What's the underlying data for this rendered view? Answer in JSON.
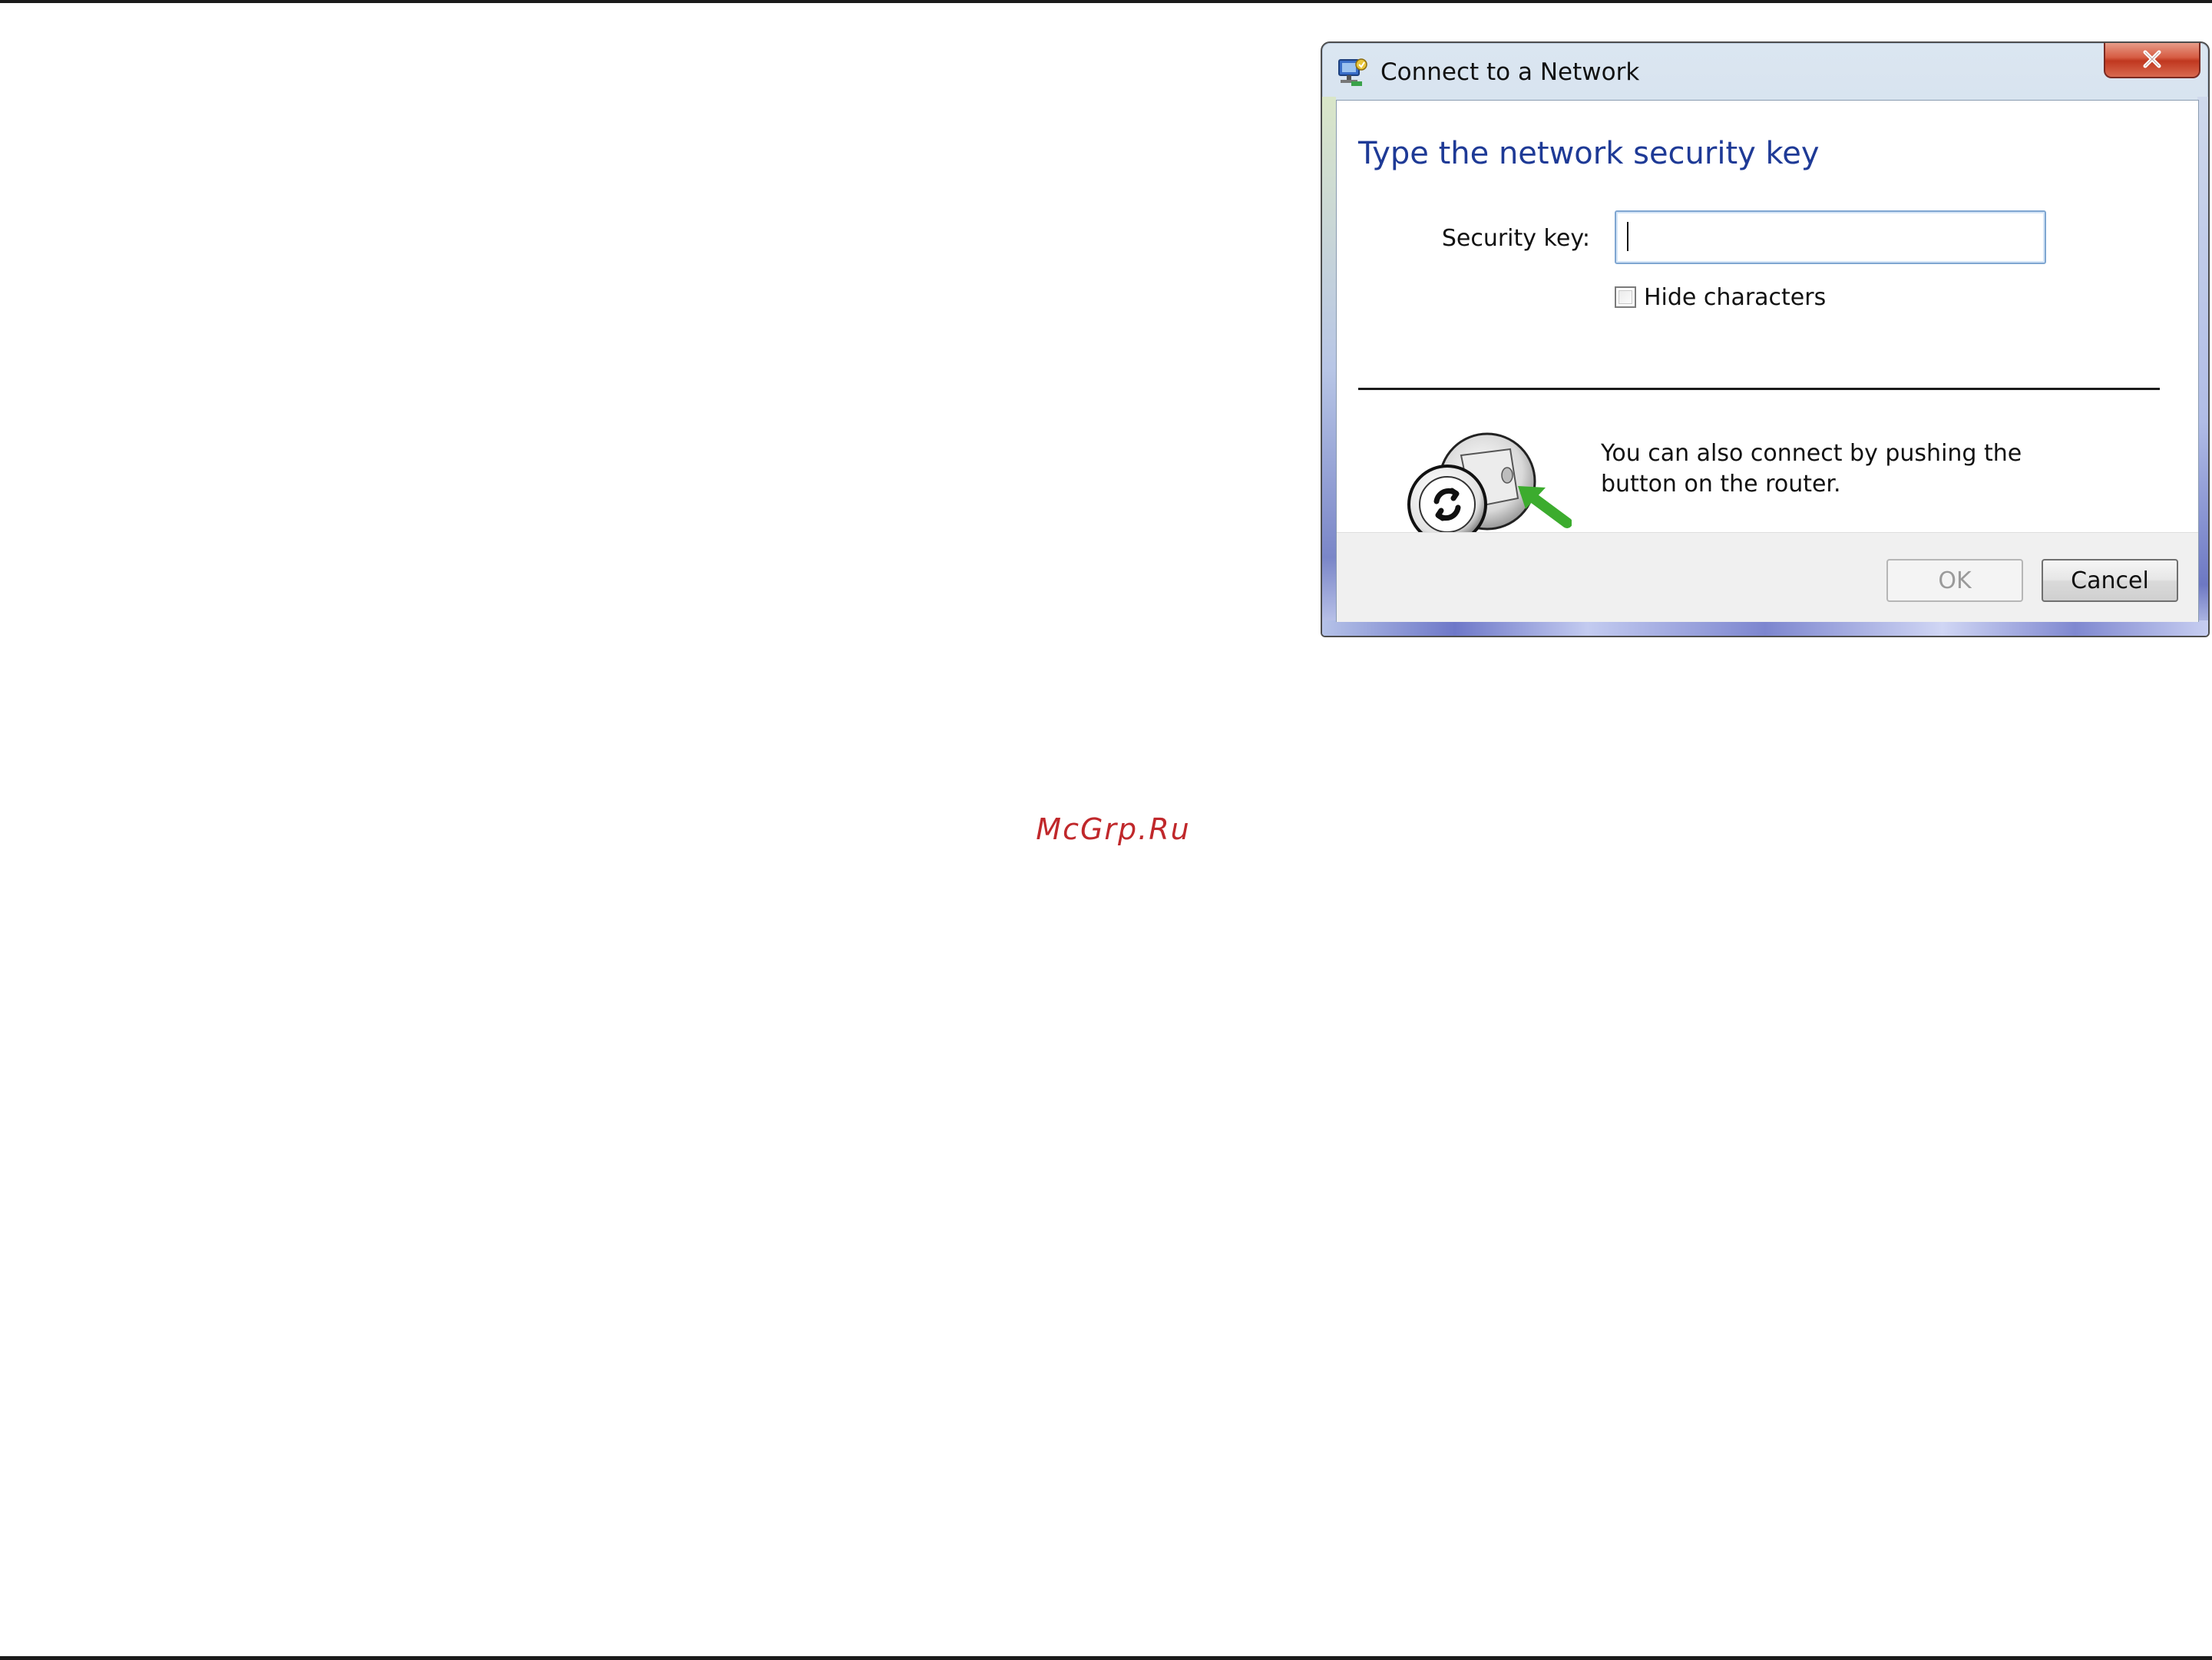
{
  "page": {
    "watermark": "McGrp.Ru"
  },
  "dialog": {
    "title": "Connect to a Network",
    "heading": "Type the network security key",
    "security_key_label": "Security key:",
    "security_key_value": "",
    "hide_characters_label": "Hide characters",
    "hide_characters_checked": false,
    "wps_text": "You can also connect by pushing the button on the router.",
    "ok_label": "OK",
    "cancel_label": "Cancel",
    "close_icon": "close-icon",
    "title_icon": "network-icon",
    "wps_icon": "wps-router-icon",
    "colors": {
      "heading": "#1e3a96",
      "close_button": "#c0371f",
      "watermark": "#c0282b"
    }
  }
}
